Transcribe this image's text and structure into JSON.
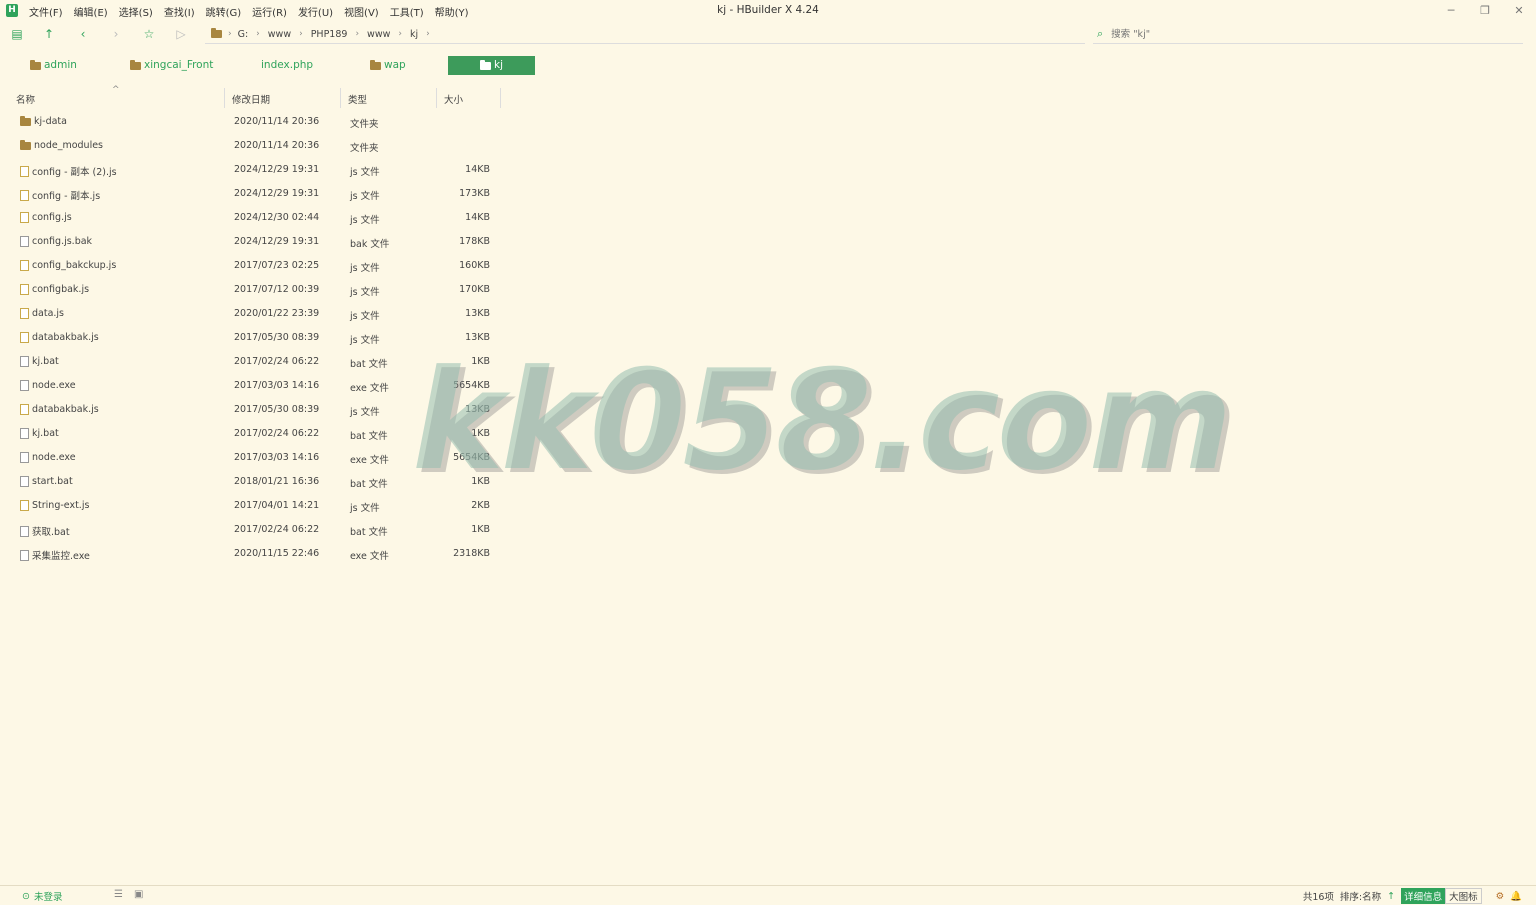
{
  "window": {
    "title": "kj - HBuilder X 4.24",
    "logo": "H",
    "minimize": "─",
    "restore": "❐",
    "close": "✕"
  },
  "menu": [
    "文件(F)",
    "编辑(E)",
    "选择(S)",
    "查找(I)",
    "跳转(G)",
    "运行(R)",
    "发行(U)",
    "视图(V)",
    "工具(T)",
    "帮助(Y)"
  ],
  "toolbar": {
    "icons": [
      "new-file-icon",
      "up-icon",
      "back-icon",
      "forward-icon",
      "star-icon",
      "play-icon"
    ],
    "breadcrumb": [
      "G:",
      "www",
      "PHP189",
      "www",
      "kj"
    ],
    "search_placeholder": "搜索 \"kj\""
  },
  "tabs": [
    {
      "label": "admin",
      "type": "folder"
    },
    {
      "label": "xingcai_Front",
      "type": "folder"
    },
    {
      "label": "index.php",
      "type": "file"
    },
    {
      "label": "wap",
      "type": "folder"
    },
    {
      "label": "kj",
      "type": "folder",
      "active": true
    }
  ],
  "columns": {
    "name": "名称",
    "date": "修改日期",
    "type": "类型",
    "size": "大小"
  },
  "files": [
    {
      "name": "kj-data",
      "date": "2020/11/14 20:36",
      "type": "文件夹",
      "size": "",
      "icon": "folder"
    },
    {
      "name": "node_modules",
      "date": "2020/11/14 20:36",
      "type": "文件夹",
      "size": "",
      "icon": "folder"
    },
    {
      "name": "config - 副本 (2).js",
      "date": "2024/12/29 19:31",
      "type": "js 文件",
      "size": "14KB",
      "icon": "js"
    },
    {
      "name": "config - 副本.js",
      "date": "2024/12/29 19:31",
      "type": "js 文件",
      "size": "173KB",
      "icon": "js"
    },
    {
      "name": "config.js",
      "date": "2024/12/30 02:44",
      "type": "js 文件",
      "size": "14KB",
      "icon": "js"
    },
    {
      "name": "config.js.bak",
      "date": "2024/12/29 19:31",
      "type": "bak 文件",
      "size": "178KB",
      "icon": "file"
    },
    {
      "name": "config_bakckup.js",
      "date": "2017/07/23 02:25",
      "type": "js 文件",
      "size": "160KB",
      "icon": "js"
    },
    {
      "name": "configbak.js",
      "date": "2017/07/12 00:39",
      "type": "js 文件",
      "size": "170KB",
      "icon": "js"
    },
    {
      "name": "data.js",
      "date": "2020/01/22 23:39",
      "type": "js 文件",
      "size": "13KB",
      "icon": "js"
    },
    {
      "name": "databakbak.js",
      "date": "2017/05/30 08:39",
      "type": "js 文件",
      "size": "13KB",
      "icon": "js"
    },
    {
      "name": "kj.bat",
      "date": "2017/02/24 06:22",
      "type": "bat 文件",
      "size": "1KB",
      "icon": "file"
    },
    {
      "name": "node.exe",
      "date": "2017/03/03 14:16",
      "type": "exe 文件",
      "size": "5654KB",
      "icon": "file"
    },
    {
      "name": "databakbak.js",
      "date": "2017/05/30 08:39",
      "type": "js 文件",
      "size": "13KB",
      "icon": "js"
    },
    {
      "name": "kj.bat",
      "date": "2017/02/24 06:22",
      "type": "bat 文件",
      "size": "1KB",
      "icon": "file"
    },
    {
      "name": "node.exe",
      "date": "2017/03/03 14:16",
      "type": "exe 文件",
      "size": "5654KB",
      "icon": "file"
    },
    {
      "name": "start.bat",
      "date": "2018/01/21 16:36",
      "type": "bat 文件",
      "size": "1KB",
      "icon": "file"
    },
    {
      "name": "String-ext.js",
      "date": "2017/04/01 14:21",
      "type": "js 文件",
      "size": "2KB",
      "icon": "js"
    },
    {
      "name": "获取.bat",
      "date": "2017/02/24 06:22",
      "type": "bat 文件",
      "size": "1KB",
      "icon": "file"
    },
    {
      "name": "采集监控.exe",
      "date": "2020/11/15 22:46",
      "type": "exe 文件",
      "size": "2318KB",
      "icon": "file"
    }
  ],
  "watermark": "kk058.com",
  "status": {
    "login": "未登录",
    "count": "共16项",
    "sort": "排序:名称",
    "sort_arrow": "↑",
    "detail_btn": "详细信息",
    "big_icon_btn": "大图标"
  }
}
